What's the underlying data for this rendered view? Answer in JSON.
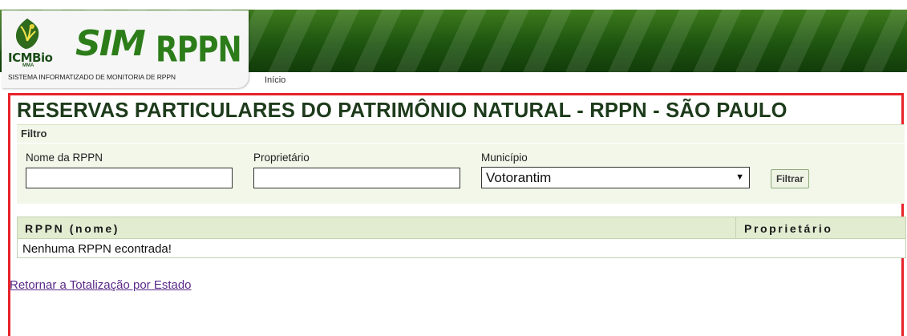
{
  "header": {
    "logo_icmbio": "ICMBio",
    "logo_mma": "MMA",
    "brand_sim": "SIM",
    "brand_rppn": "RPPN",
    "brand_subtitle": "SISTEMA INFORMATIZADO DE MONITORIA DE RPPN",
    "nav_home": "Início",
    "banner_color": "#1d5410"
  },
  "page": {
    "title": "RESERVAS PARTICULARES DO PATRIMÔNIO NATURAL - RPPN - SÃO PAULO"
  },
  "filter": {
    "title": "Filtro",
    "name_label": "Nome da RPPN",
    "name_value": "",
    "owner_label": "Proprietário",
    "owner_value": "",
    "municipality_label": "Município",
    "municipality_selected": "Votorantim",
    "submit_label": "Filtrar"
  },
  "table": {
    "columns": [
      "RPPN (nome)",
      "Proprietário"
    ],
    "empty_message": "Nenhuma RPPN econtrada!"
  },
  "links": {
    "back": "Retornar a Totalização por Estado"
  },
  "colors": {
    "frame_border": "#e8232a",
    "panel_bg": "#f2f7ea",
    "header_row_bg": "#e1ecd1"
  }
}
